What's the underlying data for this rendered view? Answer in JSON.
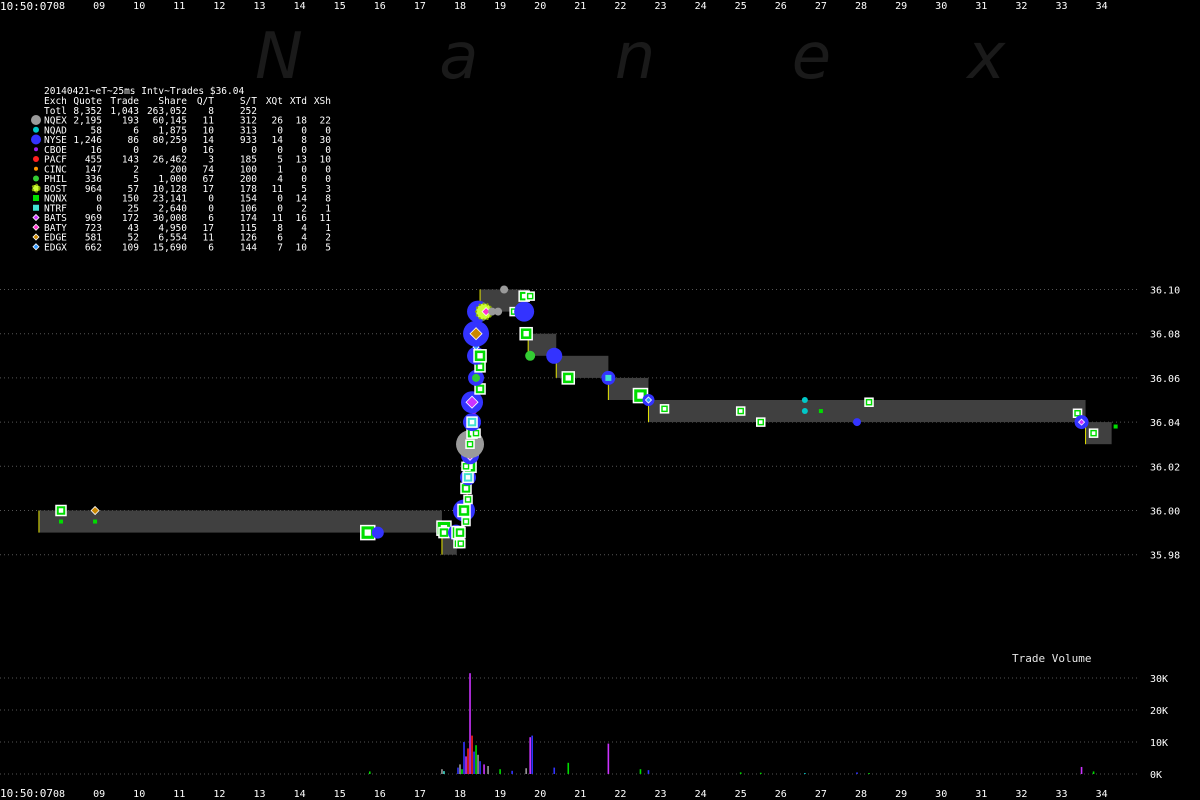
{
  "watermark": "N a n e x",
  "time_label": "10:50:07",
  "volume_title": "Trade Volume",
  "chart_data": [
    {
      "type": "scatter",
      "title": "20140421~eT~25ms Intv~Trades $36.04",
      "x_unit": "seconds past 10:50",
      "x_ticks": [
        "08",
        "09",
        "10",
        "11",
        "12",
        "13",
        "14",
        "15",
        "16",
        "17",
        "18",
        "19",
        "20",
        "21",
        "22",
        "23",
        "24",
        "25",
        "26",
        "27",
        "28",
        "29",
        "30",
        "31",
        "32",
        "33",
        "34"
      ],
      "xlim": [
        7.5,
        35.3
      ],
      "ylim": [
        35.975,
        36.115
      ],
      "y_ticks": [
        "35.98",
        "36.00",
        "36.02",
        "36.04",
        "36.06",
        "36.08",
        "36.10"
      ],
      "nbbo_bands": [
        {
          "x": [
            7.5,
            17.55
          ],
          "bid": 35.99,
          "ask": 36.0
        },
        {
          "x": [
            17.55,
            17.92
          ],
          "bid": 35.98,
          "ask": 35.99
        },
        {
          "x": [
            18.5,
            19.7
          ],
          "bid": 36.09,
          "ask": 36.1
        },
        {
          "x": [
            19.7,
            20.4
          ],
          "bid": 36.07,
          "ask": 36.08
        },
        {
          "x": [
            20.4,
            21.7
          ],
          "bid": 36.06,
          "ask": 36.07
        },
        {
          "x": [
            21.7,
            22.7
          ],
          "bid": 36.05,
          "ask": 36.06
        },
        {
          "x": [
            22.7,
            33.6
          ],
          "bid": 36.04,
          "ask": 36.05
        },
        {
          "x": [
            33.6,
            34.25
          ],
          "bid": 36.03,
          "ask": 36.04
        }
      ],
      "legend": {
        "headers": [
          "Exch",
          "Quote",
          "Trade",
          "Share",
          "Q/T",
          "S/T",
          "XQt",
          "XTd",
          "XSh"
        ],
        "total": [
          "Totl",
          "8,352",
          "1,043",
          "263,052",
          "8",
          "252",
          "",
          "",
          ""
        ],
        "rows": [
          {
            "cells": [
              "NQEX",
              "2,195",
              "193",
              "60,145",
              "11",
              "312",
              "26",
              "18",
              "22"
            ],
            "color": "#9a9a9a",
            "marker": "circle-big"
          },
          {
            "cells": [
              "NQAD",
              "58",
              "6",
              "1,875",
              "10",
              "313",
              "0",
              "0",
              "0"
            ],
            "color": "#00c8c8",
            "marker": "circle"
          },
          {
            "cells": [
              "NYSE",
              "1,246",
              "86",
              "80,259",
              "14",
              "933",
              "14",
              "8",
              "30"
            ],
            "color": "#3333ff",
            "marker": "circle-big"
          },
          {
            "cells": [
              "CBOE",
              "16",
              "0",
              "0",
              "16",
              "0",
              "0",
              "0",
              "0"
            ],
            "color": "#a020f0",
            "marker": "circle-small"
          },
          {
            "cells": [
              "PACF",
              "455",
              "143",
              "26,462",
              "3",
              "185",
              "5",
              "13",
              "10"
            ],
            "color": "#ff2020",
            "marker": "circle"
          },
          {
            "cells": [
              "CINC",
              "147",
              "2",
              "200",
              "74",
              "100",
              "1",
              "0",
              "0"
            ],
            "color": "#ff9900",
            "marker": "circle-small"
          },
          {
            "cells": [
              "PHIL",
              "336",
              "5",
              "1,000",
              "67",
              "200",
              "4",
              "0",
              "0"
            ],
            "color": "#33cc33",
            "marker": "circle"
          },
          {
            "cells": [
              "BOST",
              "964",
              "57",
              "10,128",
              "17",
              "178",
              "11",
              "5",
              "3"
            ],
            "color": "#ccff33",
            "marker": "gear"
          },
          {
            "cells": [
              "NQNX",
              "0",
              "150",
              "23,141",
              "0",
              "154",
              "0",
              "14",
              "8"
            ],
            "color": "#00dd00",
            "marker": "square"
          },
          {
            "cells": [
              "NTRF",
              "0",
              "25",
              "2,640",
              "0",
              "106",
              "0",
              "2",
              "1"
            ],
            "color": "#40e0d0",
            "marker": "square"
          },
          {
            "cells": [
              "BATS",
              "969",
              "172",
              "30,008",
              "6",
              "174",
              "11",
              "16",
              "11"
            ],
            "color": "#cc33ff",
            "marker": "diamond"
          },
          {
            "cells": [
              "BATY",
              "723",
              "43",
              "4,950",
              "17",
              "115",
              "8",
              "4",
              "1"
            ],
            "color": "#ff33cc",
            "marker": "diamond"
          },
          {
            "cells": [
              "EDGE",
              "581",
              "52",
              "6,554",
              "11",
              "126",
              "6",
              "4",
              "2"
            ],
            "color": "#cc8800",
            "marker": "diamond"
          },
          {
            "cells": [
              "EDGX",
              "662",
              "109",
              "15,690",
              "6",
              "144",
              "7",
              "10",
              "5"
            ],
            "color": "#3399ff",
            "marker": "diamond"
          }
        ]
      },
      "trades": [
        {
          "x": 8.05,
          "y": 36.0,
          "ex": "NQNX",
          "size": 5
        },
        {
          "x": 8.05,
          "y": 35.995,
          "ex": "NQNX",
          "size": 2
        },
        {
          "x": 8.9,
          "y": 36.0,
          "ex": "EDGE",
          "size": 4
        },
        {
          "x": 8.9,
          "y": 35.995,
          "ex": "NQNX",
          "size": 2
        },
        {
          "x": 15.7,
          "y": 35.99,
          "ex": "NQNX",
          "size": 7
        },
        {
          "x": 15.95,
          "y": 35.99,
          "ex": "NYSE",
          "size": 6
        },
        {
          "x": 17.6,
          "y": 35.992,
          "ex": "NQNX",
          "size": 7
        },
        {
          "x": 17.6,
          "y": 35.99,
          "ex": "NQNX",
          "size": 5
        },
        {
          "x": 17.9,
          "y": 35.99,
          "ex": "NYSE",
          "size": 8
        },
        {
          "x": 17.95,
          "y": 35.99,
          "ex": "NQNX",
          "size": 6
        },
        {
          "x": 18.0,
          "y": 35.99,
          "ex": "NQNX",
          "size": 5
        },
        {
          "x": 17.95,
          "y": 35.985,
          "ex": "NQNX",
          "size": 4
        },
        {
          "x": 18.02,
          "y": 35.985,
          "ex": "NQNX",
          "size": 4
        },
        {
          "x": 18.1,
          "y": 36.0,
          "ex": "NYSE",
          "size": 11
        },
        {
          "x": 18.1,
          "y": 36.0,
          "ex": "NQNX",
          "size": 6
        },
        {
          "x": 18.15,
          "y": 35.995,
          "ex": "NQNX",
          "size": 4
        },
        {
          "x": 18.2,
          "y": 36.005,
          "ex": "NQNX",
          "size": 4
        },
        {
          "x": 18.15,
          "y": 36.01,
          "ex": "NQNX",
          "size": 5
        },
        {
          "x": 18.2,
          "y": 36.015,
          "ex": "NYSE",
          "size": 8
        },
        {
          "x": 18.2,
          "y": 36.015,
          "ex": "NTRF",
          "size": 5
        },
        {
          "x": 18.25,
          "y": 36.02,
          "ex": "NQNX",
          "size": 6
        },
        {
          "x": 18.15,
          "y": 36.02,
          "ex": "NQNX",
          "size": 4
        },
        {
          "x": 18.25,
          "y": 36.025,
          "ex": "NYSE",
          "size": 9
        },
        {
          "x": 18.25,
          "y": 36.025,
          "ex": "BATS",
          "size": 5
        },
        {
          "x": 18.35,
          "y": 36.027,
          "ex": "NQNX",
          "size": 4
        },
        {
          "x": 18.25,
          "y": 36.03,
          "ex": "NQEX",
          "size": 14
        },
        {
          "x": 18.25,
          "y": 36.03,
          "ex": "NQNX",
          "size": 4
        },
        {
          "x": 18.3,
          "y": 36.035,
          "ex": "NQNX",
          "size": 5
        },
        {
          "x": 18.4,
          "y": 36.035,
          "ex": "NQNX",
          "size": 4
        },
        {
          "x": 18.3,
          "y": 36.04,
          "ex": "NYSE",
          "size": 9
        },
        {
          "x": 18.3,
          "y": 36.04,
          "ex": "NTRF",
          "size": 5
        },
        {
          "x": 18.35,
          "y": 36.045,
          "ex": "CBOE",
          "size": 3
        },
        {
          "x": 18.3,
          "y": 36.049,
          "ex": "NYSE",
          "size": 11
        },
        {
          "x": 18.3,
          "y": 36.049,
          "ex": "BATS",
          "size": 6
        },
        {
          "x": 18.5,
          "y": 36.055,
          "ex": "NQNX",
          "size": 5
        },
        {
          "x": 18.4,
          "y": 36.06,
          "ex": "NYSE",
          "size": 8
        },
        {
          "x": 18.4,
          "y": 36.06,
          "ex": "PHIL",
          "size": 4
        },
        {
          "x": 18.5,
          "y": 36.065,
          "ex": "NQNX",
          "size": 5
        },
        {
          "x": 18.4,
          "y": 36.068,
          "ex": "PACF",
          "size": 3
        },
        {
          "x": 18.4,
          "y": 36.07,
          "ex": "NYSE",
          "size": 9
        },
        {
          "x": 18.5,
          "y": 36.07,
          "ex": "NQNX",
          "size": 6
        },
        {
          "x": 18.4,
          "y": 36.074,
          "ex": "EDGX",
          "size": 3
        },
        {
          "x": 18.4,
          "y": 36.08,
          "ex": "NYSE",
          "size": 13
        },
        {
          "x": 18.4,
          "y": 36.08,
          "ex": "EDGE",
          "size": 6
        },
        {
          "x": 18.45,
          "y": 36.09,
          "ex": "NYSE",
          "size": 11
        },
        {
          "x": 18.6,
          "y": 36.09,
          "ex": "BOST",
          "size": 8
        },
        {
          "x": 18.65,
          "y": 36.09,
          "ex": "BATY",
          "size": 4
        },
        {
          "x": 18.8,
          "y": 36.09,
          "ex": "NQEX",
          "size": 4
        },
        {
          "x": 18.95,
          "y": 36.09,
          "ex": "NQEX",
          "size": 4
        },
        {
          "x": 19.1,
          "y": 36.1,
          "ex": "NQEX",
          "size": 4
        },
        {
          "x": 19.35,
          "y": 36.09,
          "ex": "NQNX",
          "size": 4
        },
        {
          "x": 19.6,
          "y": 36.09,
          "ex": "NYSE",
          "size": 10
        },
        {
          "x": 19.6,
          "y": 36.097,
          "ex": "NQNX",
          "size": 5
        },
        {
          "x": 19.75,
          "y": 36.097,
          "ex": "NQNX",
          "size": 4
        },
        {
          "x": 19.65,
          "y": 36.08,
          "ex": "NQNX",
          "size": 6
        },
        {
          "x": 19.75,
          "y": 36.07,
          "ex": "PHIL",
          "size": 5
        },
        {
          "x": 20.35,
          "y": 36.07,
          "ex": "NYSE",
          "size": 8
        },
        {
          "x": 20.7,
          "y": 36.06,
          "ex": "NQNX",
          "size": 6
        },
        {
          "x": 21.7,
          "y": 36.06,
          "ex": "NYSE",
          "size": 7
        },
        {
          "x": 21.7,
          "y": 36.06,
          "ex": "NTRF",
          "size": 3
        },
        {
          "x": 22.5,
          "y": 36.052,
          "ex": "NQNX",
          "size": 7
        },
        {
          "x": 22.7,
          "y": 36.05,
          "ex": "NYSE",
          "size": 6
        },
        {
          "x": 22.7,
          "y": 36.05,
          "ex": "EDGX",
          "size": 3
        },
        {
          "x": 23.1,
          "y": 36.046,
          "ex": "NQNX",
          "size": 4
        },
        {
          "x": 25.0,
          "y": 36.045,
          "ex": "NQNX",
          "size": 4
        },
        {
          "x": 25.5,
          "y": 36.04,
          "ex": "NQNX",
          "size": 4
        },
        {
          "x": 26.6,
          "y": 36.05,
          "ex": "NQAD",
          "size": 3
        },
        {
          "x": 26.6,
          "y": 36.045,
          "ex": "NQAD",
          "size": 3
        },
        {
          "x": 27.0,
          "y": 36.045,
          "ex": "NQNX",
          "size": 2
        },
        {
          "x": 27.9,
          "y": 36.04,
          "ex": "NYSE",
          "size": 4
        },
        {
          "x": 28.2,
          "y": 36.049,
          "ex": "NQNX",
          "size": 4
        },
        {
          "x": 33.4,
          "y": 36.044,
          "ex": "NQNX",
          "size": 4
        },
        {
          "x": 33.5,
          "y": 36.04,
          "ex": "NYSE",
          "size": 7
        },
        {
          "x": 33.5,
          "y": 36.04,
          "ex": "BATS",
          "size": 3
        },
        {
          "x": 33.8,
          "y": 36.035,
          "ex": "NQNX",
          "size": 4
        },
        {
          "x": 34.35,
          "y": 36.038,
          "ex": "NQNX",
          "size": 2
        }
      ]
    },
    {
      "type": "bar",
      "title": "Trade Volume",
      "y_ticks": [
        "0K",
        "10K",
        "20K",
        "30K"
      ],
      "ylim": [
        0,
        35000
      ],
      "bars": [
        {
          "x": 15.75,
          "v": 800,
          "color": "#00dd00"
        },
        {
          "x": 17.55,
          "v": 1500,
          "color": "#9a9a9a"
        },
        {
          "x": 17.6,
          "v": 900,
          "color": "#40e0d0"
        },
        {
          "x": 17.95,
          "v": 2000,
          "color": "#3333ff"
        },
        {
          "x": 18.0,
          "v": 3000,
          "color": "#9a9a9a"
        },
        {
          "x": 18.05,
          "v": 1500,
          "color": "#00dd00"
        },
        {
          "x": 18.1,
          "v": 10000,
          "color": "#3333ff"
        },
        {
          "x": 18.15,
          "v": 5500,
          "color": "#cc33ff"
        },
        {
          "x": 18.2,
          "v": 8000,
          "color": "#ff2020"
        },
        {
          "x": 18.25,
          "v": 31500,
          "color": "#cc33ff"
        },
        {
          "x": 18.3,
          "v": 12000,
          "color": "#ff2020"
        },
        {
          "x": 18.35,
          "v": 7000,
          "color": "#3333ff"
        },
        {
          "x": 18.4,
          "v": 9000,
          "color": "#00dd00"
        },
        {
          "x": 18.45,
          "v": 6000,
          "color": "#9a9a9a"
        },
        {
          "x": 18.5,
          "v": 4000,
          "color": "#3333ff"
        },
        {
          "x": 18.6,
          "v": 3000,
          "color": "#cc33ff"
        },
        {
          "x": 18.7,
          "v": 2500,
          "color": "#9a9a9a"
        },
        {
          "x": 19.0,
          "v": 1500,
          "color": "#00dd00"
        },
        {
          "x": 19.3,
          "v": 1000,
          "color": "#3333ff"
        },
        {
          "x": 19.65,
          "v": 1800,
          "color": "#9a9a9a"
        },
        {
          "x": 19.75,
          "v": 11500,
          "color": "#cc33ff"
        },
        {
          "x": 19.8,
          "v": 12000,
          "color": "#3333ff"
        },
        {
          "x": 20.35,
          "v": 2000,
          "color": "#3333ff"
        },
        {
          "x": 20.7,
          "v": 3500,
          "color": "#00dd00"
        },
        {
          "x": 21.7,
          "v": 9500,
          "color": "#cc33ff"
        },
        {
          "x": 22.5,
          "v": 1500,
          "color": "#00dd00"
        },
        {
          "x": 22.7,
          "v": 1200,
          "color": "#3333ff"
        },
        {
          "x": 25.0,
          "v": 500,
          "color": "#00dd00"
        },
        {
          "x": 25.5,
          "v": 400,
          "color": "#00dd00"
        },
        {
          "x": 26.6,
          "v": 300,
          "color": "#00c8c8"
        },
        {
          "x": 27.9,
          "v": 500,
          "color": "#3333ff"
        },
        {
          "x": 28.2,
          "v": 300,
          "color": "#00dd00"
        },
        {
          "x": 33.5,
          "v": 2200,
          "color": "#cc33ff"
        },
        {
          "x": 33.8,
          "v": 800,
          "color": "#00dd00"
        }
      ]
    }
  ]
}
